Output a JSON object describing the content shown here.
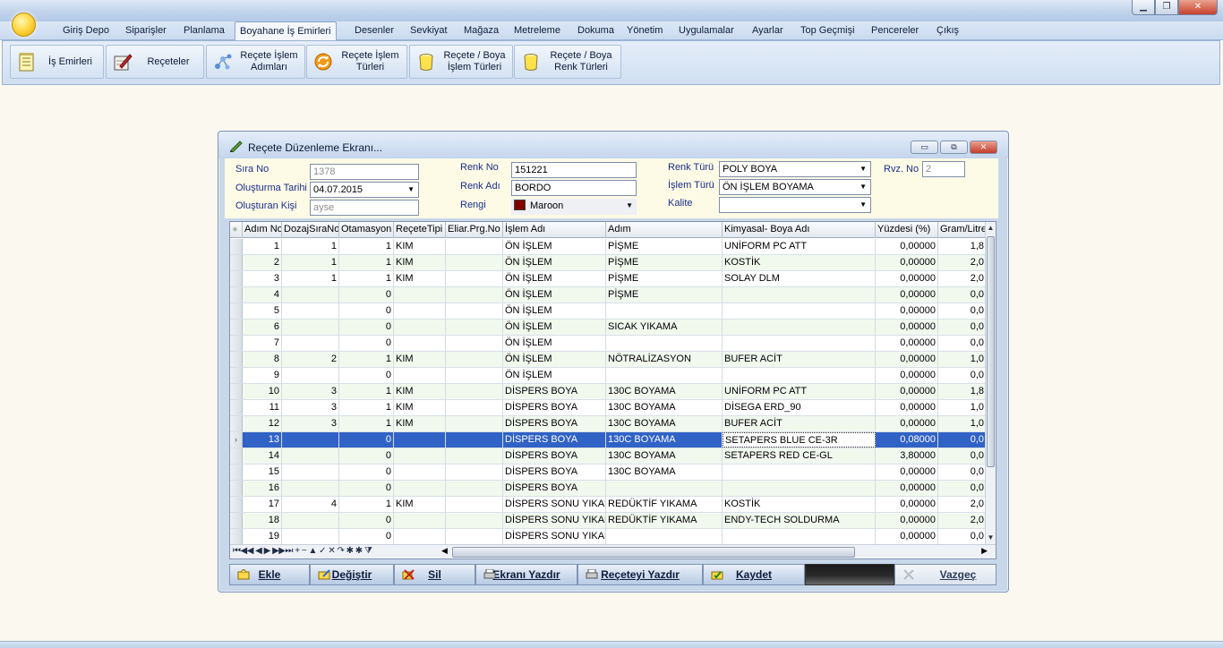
{
  "window": {
    "min": "▁",
    "max": "❐",
    "close": "✕"
  },
  "menu": [
    "Giriş Depo",
    "Siparişler",
    "Planlama",
    "Boyahane İş Emirleri",
    "Desenler",
    "Sevkiyat",
    "Mağaza",
    "Metreleme",
    "Dokuma",
    "Yönetim",
    "Uygulamalar",
    "Ayarlar",
    "Top Geçmişi",
    "Pencereler",
    "Çıkış"
  ],
  "menu_active": "Boyahane İş Emirleri",
  "ribbon": [
    {
      "label": "İş Emirleri",
      "icon": "notepad-icon"
    },
    {
      "label": "Reçeteler",
      "icon": "recipe-pen-icon"
    },
    {
      "label": "Reçete İşlem Adımları",
      "icon": "molecule-icon"
    },
    {
      "label": "Reçete İşlem Türleri",
      "icon": "refresh-orange-icon"
    },
    {
      "label": "Reçete / Boya İşlem Türleri",
      "icon": "paint-bucket-icon"
    },
    {
      "label": "Reçete / Boya Renk Türleri",
      "icon": "paint-bucket-icon"
    }
  ],
  "dialog": {
    "title": "Reçete Düzenleme Ekranı...",
    "btn_min": "▭",
    "btn_max": "⧉",
    "btn_close": "✕",
    "form": {
      "sira_no_label": "Sıra No",
      "sira_no": "1378",
      "olusturma_tarihi_label": "Oluşturma Tarihi",
      "olusturma_tarihi": "04.07.2015",
      "olusturan_label": "Oluşturan Kişi",
      "olusturan": "ayse",
      "renk_no_label": "Renk No",
      "renk_no": "151221",
      "renk_adi_label": "Renk Adı",
      "renk_adi": "BORDO",
      "rengi_label": "Rengi",
      "rengi": "Maroon",
      "rengi_color": "#800000",
      "renk_turu_label": "Renk Türü",
      "renk_turu": "POLY BOYA",
      "islem_turu_label": "İşlem Türü",
      "islem_turu": "ÖN İŞLEM BOYAMA",
      "kalite_label": "Kalite",
      "kalite": "",
      "rvz_no_label": "Rvz. No",
      "rvz_no": "2"
    },
    "grid": {
      "columns": [
        "Adım No",
        "DozajSıraNo",
        "Otamasyon",
        "ReçeteTipi",
        "Eliar.Prg.No",
        "İşlem Adı",
        "Adım",
        "Kimyasal- Boya Adı",
        "Yüzdesi (%)",
        "Gram/Litre"
      ],
      "rows": [
        [
          "1",
          "1",
          "1",
          "KIM",
          "",
          "ÖN İŞLEM",
          "PİŞME",
          "UNİFORM PC ATT",
          "0,00000",
          "1,8"
        ],
        [
          "2",
          "1",
          "1",
          "KIM",
          "",
          "ÖN İŞLEM",
          "PİŞME",
          "KOSTİK",
          "0,00000",
          "2,0"
        ],
        [
          "3",
          "1",
          "1",
          "KIM",
          "",
          "ÖN İŞLEM",
          "PİŞME",
          "SOLAY DLM",
          "0,00000",
          "2,0"
        ],
        [
          "4",
          "",
          "0",
          "",
          "",
          "ÖN İŞLEM",
          "PİŞME",
          "",
          "0,00000",
          "0,0"
        ],
        [
          "5",
          "",
          "0",
          "",
          "",
          "ÖN İŞLEM",
          "",
          "",
          "0,00000",
          "0,0"
        ],
        [
          "6",
          "",
          "0",
          "",
          "",
          "ÖN İŞLEM",
          "SICAK YIKAMA",
          "",
          "0,00000",
          "0,0"
        ],
        [
          "7",
          "",
          "0",
          "",
          "",
          "ÖN İŞLEM",
          "",
          "",
          "0,00000",
          "0,0"
        ],
        [
          "8",
          "2",
          "1",
          "KIM",
          "",
          "ÖN İŞLEM",
          "NÖTRALİZASYON",
          "BUFER ACİT",
          "0,00000",
          "1,0"
        ],
        [
          "9",
          "",
          "0",
          "",
          "",
          "ÖN İŞLEM",
          "",
          "",
          "0,00000",
          "0,0"
        ],
        [
          "10",
          "3",
          "1",
          "KIM",
          "",
          "DİSPERS BOYA",
          "130C BOYAMA",
          "UNİFORM PC ATT",
          "0,00000",
          "1,8"
        ],
        [
          "11",
          "3",
          "1",
          "KIM",
          "",
          "DİSPERS BOYA",
          "130C BOYAMA",
          "DİSEGA ERD_90",
          "0,00000",
          "1,0"
        ],
        [
          "12",
          "3",
          "1",
          "KIM",
          "",
          "DİSPERS BOYA",
          "130C BOYAMA",
          "BUFER ACİT",
          "0,00000",
          "1,0"
        ],
        [
          "13",
          "",
          "0",
          "",
          "",
          "DİSPERS BOYA",
          "130C BOYAMA",
          "SETAPERS BLUE CE-3R",
          "0,08000",
          "0,0"
        ],
        [
          "14",
          "",
          "0",
          "",
          "",
          "DİSPERS BOYA",
          "130C BOYAMA",
          "SETAPERS RED CE-GL",
          "3,80000",
          "0,0"
        ],
        [
          "15",
          "",
          "0",
          "",
          "",
          "DİSPERS BOYA",
          "130C BOYAMA",
          "",
          "0,00000",
          "0,0"
        ],
        [
          "16",
          "",
          "0",
          "",
          "",
          "DİSPERS BOYA",
          "",
          "",
          "0,00000",
          "0,0"
        ],
        [
          "17",
          "4",
          "1",
          "KIM",
          "",
          "DİSPERS SONU YIKAMA",
          "REDÜKTİF YIKAMA",
          "KOSTİK",
          "0,00000",
          "2,0"
        ],
        [
          "18",
          "",
          "0",
          "",
          "",
          "DİSPERS SONU YIKAMA",
          "REDÜKTİF YIKAMA",
          "ENDY-TECH SOLDURMA",
          "0,00000",
          "2,0"
        ],
        [
          "19",
          "",
          "0",
          "",
          "",
          "DİSPERS SONU YIKAMA",
          "",
          "",
          "0,00000",
          "0,0"
        ]
      ],
      "selected_row": 12,
      "row_indicator": "›",
      "nav": "⏮◀◀ ◀ ▶ ▶▶⏭ + − ▲ ✓ ✕ ↷ ✱ ✱ ⧩"
    },
    "actions": [
      {
        "label": "Ekle",
        "icon": "add-icon"
      },
      {
        "label": "Değiştir",
        "icon": "edit-icon"
      },
      {
        "label": "Sil",
        "icon": "delete-icon"
      },
      {
        "label": "Ekranı Yazdır",
        "icon": "print-screen-icon"
      },
      {
        "label": "Reçeteyi Yazdır",
        "icon": "print-recipe-icon"
      },
      {
        "label": "Kaydet",
        "icon": "save-icon"
      },
      {
        "label": "",
        "icon": ""
      },
      {
        "label": "Vazgeç",
        "icon": "cancel-icon"
      }
    ]
  }
}
